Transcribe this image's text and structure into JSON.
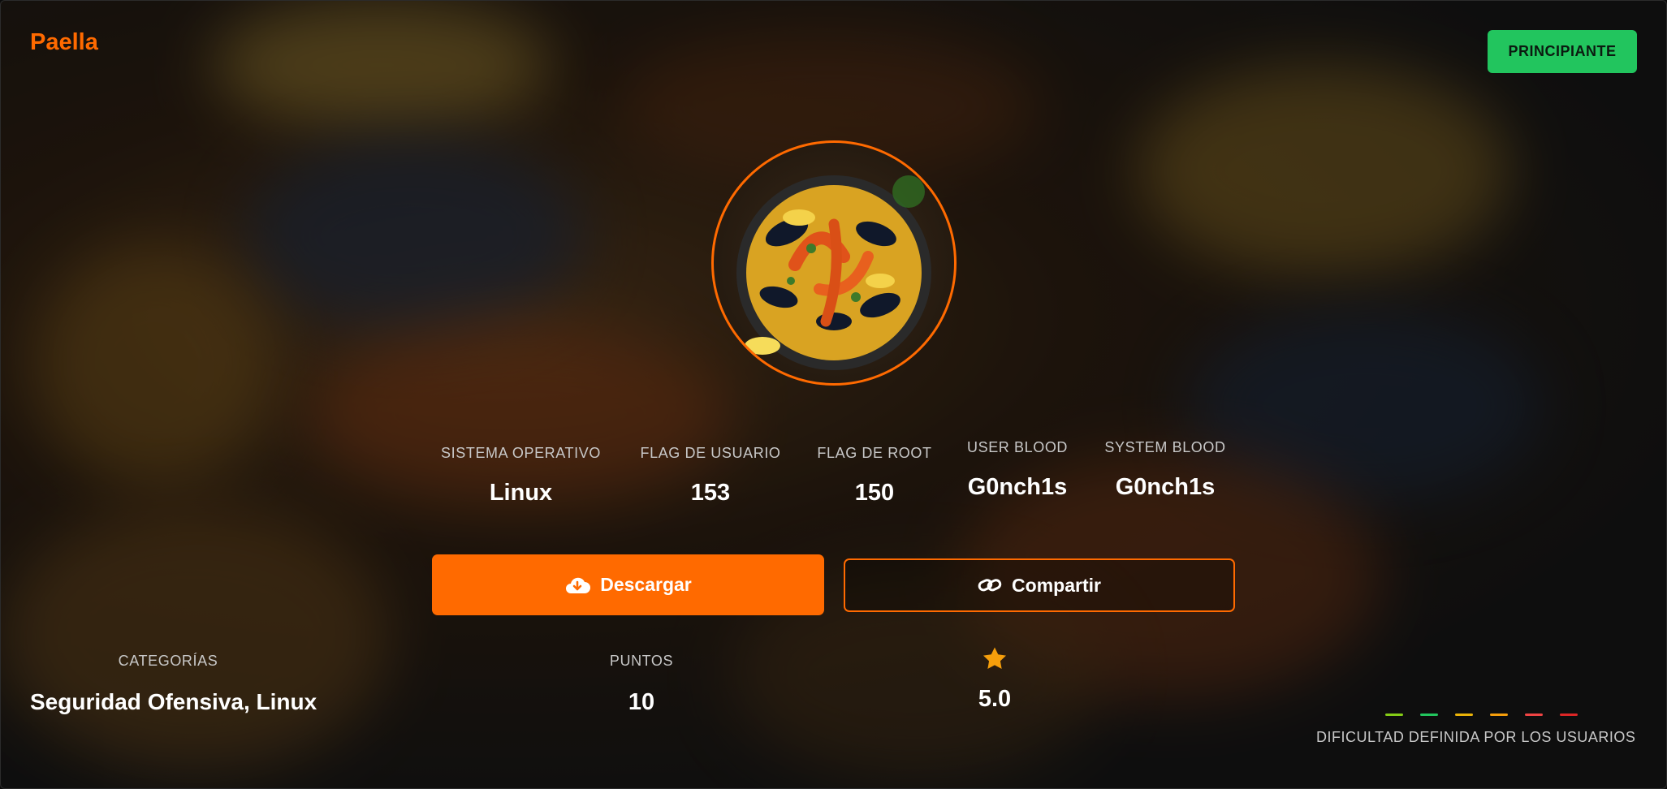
{
  "machine": {
    "name": "Paella",
    "difficulty_badge": "PRINCIPIANTE",
    "avatar_icon": "paella-dish-image"
  },
  "stats": [
    {
      "label": "SISTEMA OPERATIVO",
      "value": "Linux"
    },
    {
      "label": "FLAG DE USUARIO",
      "value": "153"
    },
    {
      "label": "FLAG DE ROOT",
      "value": "150"
    },
    {
      "label": "USER BLOOD",
      "value": "G0nch1s"
    },
    {
      "label": "SYSTEM BLOOD",
      "value": "G0nch1s"
    }
  ],
  "actions": {
    "download_label": "Descargar",
    "download_icon": "cloud-download-icon",
    "share_label": "Compartir",
    "share_icon": "link-icon"
  },
  "bottom": {
    "categories_label": "CATEGORÍAS",
    "categories_value": "Seguridad Ofensiva, Linux",
    "points_label": "PUNTOS",
    "points_value": "10",
    "rating_icon": "star-icon",
    "rating_value": "5.0"
  },
  "difficulty": {
    "label": "DIFICULTAD DEFINIDA POR LOS USUARIOS",
    "bar_colors": [
      "#84cc16",
      "#22c55e",
      "#eab308",
      "#f59e0b",
      "#ef4444",
      "#dc2626"
    ]
  },
  "colors": {
    "accent": "#ff6a00",
    "badge": "#22c55e"
  }
}
